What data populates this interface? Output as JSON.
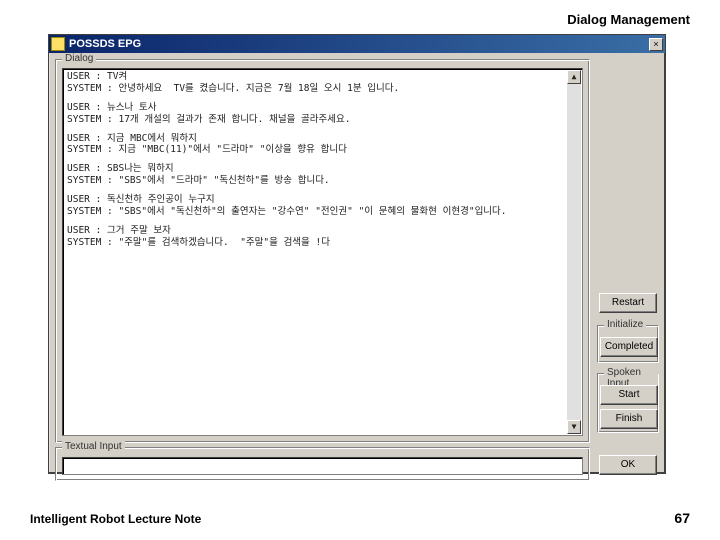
{
  "slide": {
    "header": "Dialog Management",
    "footer_left": "Intelligent Robot Lecture Note",
    "page_number": "67"
  },
  "window": {
    "title": "POSSDS EPG",
    "close_glyph": "×"
  },
  "groupboxes": {
    "dialog_label": "Dialog",
    "textual_label": "Textual Input",
    "initialize_label": "Initialize",
    "spoken_label": "Spoken Input"
  },
  "buttons": {
    "restart": "Restart",
    "completed": "Completed",
    "start": "Start",
    "finish": "Finish",
    "ok": "OK"
  },
  "textual_input": {
    "value": ""
  },
  "dialog_log": [
    {
      "user": "USER : TV켜",
      "sys": "SYSTEM : 안녕하세요  TV를 켰습니다. 지금은 7월 18일 오시 1분 입니다."
    },
    {
      "user": "USER : 뉴스나 토사",
      "sys": "SYSTEM : 17개 개설의 걸과가 존재 합니다. 채널을 골라주세요."
    },
    {
      "user": "USER : 지금 MBC에서 뭐하지",
      "sys": "SYSTEM : 지금 \"MBC(11)\"에서 \"드라마\" \"이상을 향유 합니다"
    },
    {
      "user": "USER : SBS나는 뭐하지",
      "sys": "SYSTEM : \"SBS\"에서 \"드라마\" \"독신천하\"를 방송 합니다."
    },
    {
      "user": "USER : 독신천하 주인공이 누구지",
      "sys": "SYSTEM : \"SBS\"에서 \"독신천하\"의 출연자는 \"강수연\" \"전인권\" \"이 문혜의 물화현 이현경\"입니다."
    },
    {
      "user": "USER : 그거 주말 보자",
      "sys": "SYSTEM : \"주말\"를 검색하겠습니다.  \"주말\"을 검색을 !다"
    }
  ]
}
